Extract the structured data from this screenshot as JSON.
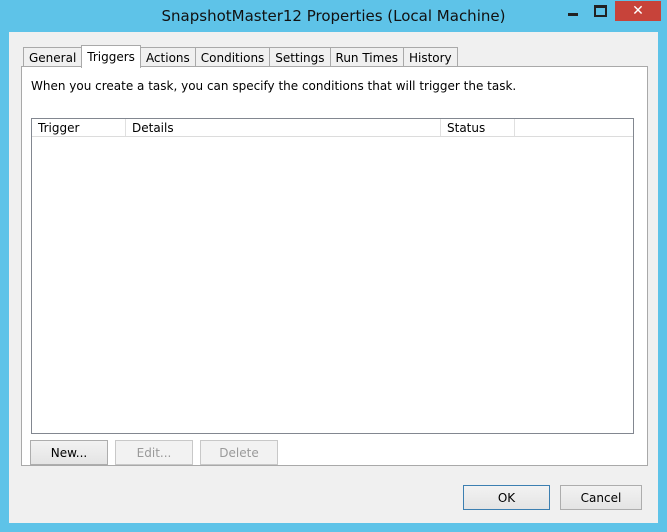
{
  "window": {
    "title": "SnapshotMaster12 Properties (Local Machine)",
    "controls": {
      "close_glyph": "✕"
    }
  },
  "tabs": [
    {
      "label": "General",
      "active": false
    },
    {
      "label": "Triggers",
      "active": true
    },
    {
      "label": "Actions",
      "active": false
    },
    {
      "label": "Conditions",
      "active": false
    },
    {
      "label": "Settings",
      "active": false
    },
    {
      "label": "Run Times",
      "active": false
    },
    {
      "label": "History",
      "active": false
    }
  ],
  "triggers_panel": {
    "description": "When you create a task, you can specify the conditions that will trigger the task.",
    "columns": [
      "Trigger",
      "Details",
      "Status"
    ],
    "rows": [],
    "buttons": {
      "new": "New...",
      "edit": "Edit...",
      "delete": "Delete"
    }
  },
  "dialog_buttons": {
    "ok": "OK",
    "cancel": "Cancel"
  },
  "colors": {
    "title_bar": "#5ec3e8",
    "close_button": "#c7433a"
  }
}
